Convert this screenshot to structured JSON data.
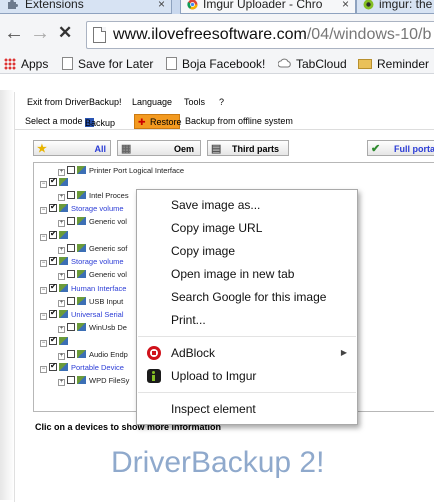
{
  "browser": {
    "tabs": [
      {
        "label": "Extensions",
        "icon": "puzzle-icon"
      },
      {
        "label": "Imgur Uploader - Chro",
        "icon": "chrome-store-icon"
      },
      {
        "label": "imgur: the",
        "icon": "imgur-icon"
      }
    ],
    "close_glyph": "×",
    "url_host": "www.ilovefreesoftware.com",
    "url_path": "/04/windows-10/b",
    "nav": {
      "back": "←",
      "forward": "→",
      "stop": "✕"
    }
  },
  "bookmarks": [
    {
      "label": "Apps",
      "icon": "apps-icon"
    },
    {
      "label": "Save for Later",
      "icon": "page-icon"
    },
    {
      "label": "Boja Facebook!",
      "icon": "page-icon"
    },
    {
      "label": "TabCloud",
      "icon": "cloud-icon"
    },
    {
      "label": "Reminder",
      "icon": "folder-icon"
    }
  ],
  "app": {
    "menus": [
      "Exit from DriverBackup!",
      "Language",
      "Tools",
      "?"
    ],
    "mode": {
      "prefix": "Select a mode",
      "backup": "Backup",
      "restore": "Restore",
      "offline": "Backup from offline system"
    },
    "filters": {
      "all": "All",
      "oem": "Oem",
      "third": "Third parts",
      "portable": "Full porta"
    },
    "tree": [
      {
        "label": "Printer Port Logical Interface",
        "color": "black"
      },
      {
        "label": "",
        "color": "black"
      },
      {
        "label": "Intel Proces",
        "color": "black"
      },
      {
        "label": "Storage volume",
        "color": "blue"
      },
      {
        "label": "Generic vol",
        "color": "black"
      },
      {
        "label": "",
        "color": "black"
      },
      {
        "label": "Generic sof",
        "color": "black"
      },
      {
        "label": "Storage volume",
        "color": "blue"
      },
      {
        "label": "Generic vol",
        "color": "black"
      },
      {
        "label": "Human Interface",
        "color": "blue"
      },
      {
        "label": "USB Input",
        "color": "black"
      },
      {
        "label": "Universal Serial",
        "color": "blue"
      },
      {
        "label": "WinUsb De",
        "color": "black"
      },
      {
        "label": "",
        "color": "black"
      },
      {
        "label": "Audio Endp",
        "color": "black"
      },
      {
        "label": "Portable Device",
        "color": "blue"
      },
      {
        "label": "WPD FileSy",
        "color": "black"
      }
    ],
    "hint": "Clic on a devices to show more information",
    "title": "DriverBackup 2!"
  },
  "context_menu": {
    "items": [
      {
        "label": "Save image as..."
      },
      {
        "label": "Copy image URL"
      },
      {
        "label": "Copy image"
      },
      {
        "label": "Open image in new tab"
      },
      {
        "label": "Search Google for this image"
      },
      {
        "label": "Print..."
      },
      {
        "label": "AdBlock"
      },
      {
        "label": "Upload to Imgur"
      },
      {
        "label": "Inspect element"
      }
    ],
    "submenu_glyph": "▶"
  },
  "colors": {
    "restore_accent": "#f39a20",
    "tree_category_blue": "#2c3dd6",
    "title_blue": "#8fa9cc"
  }
}
